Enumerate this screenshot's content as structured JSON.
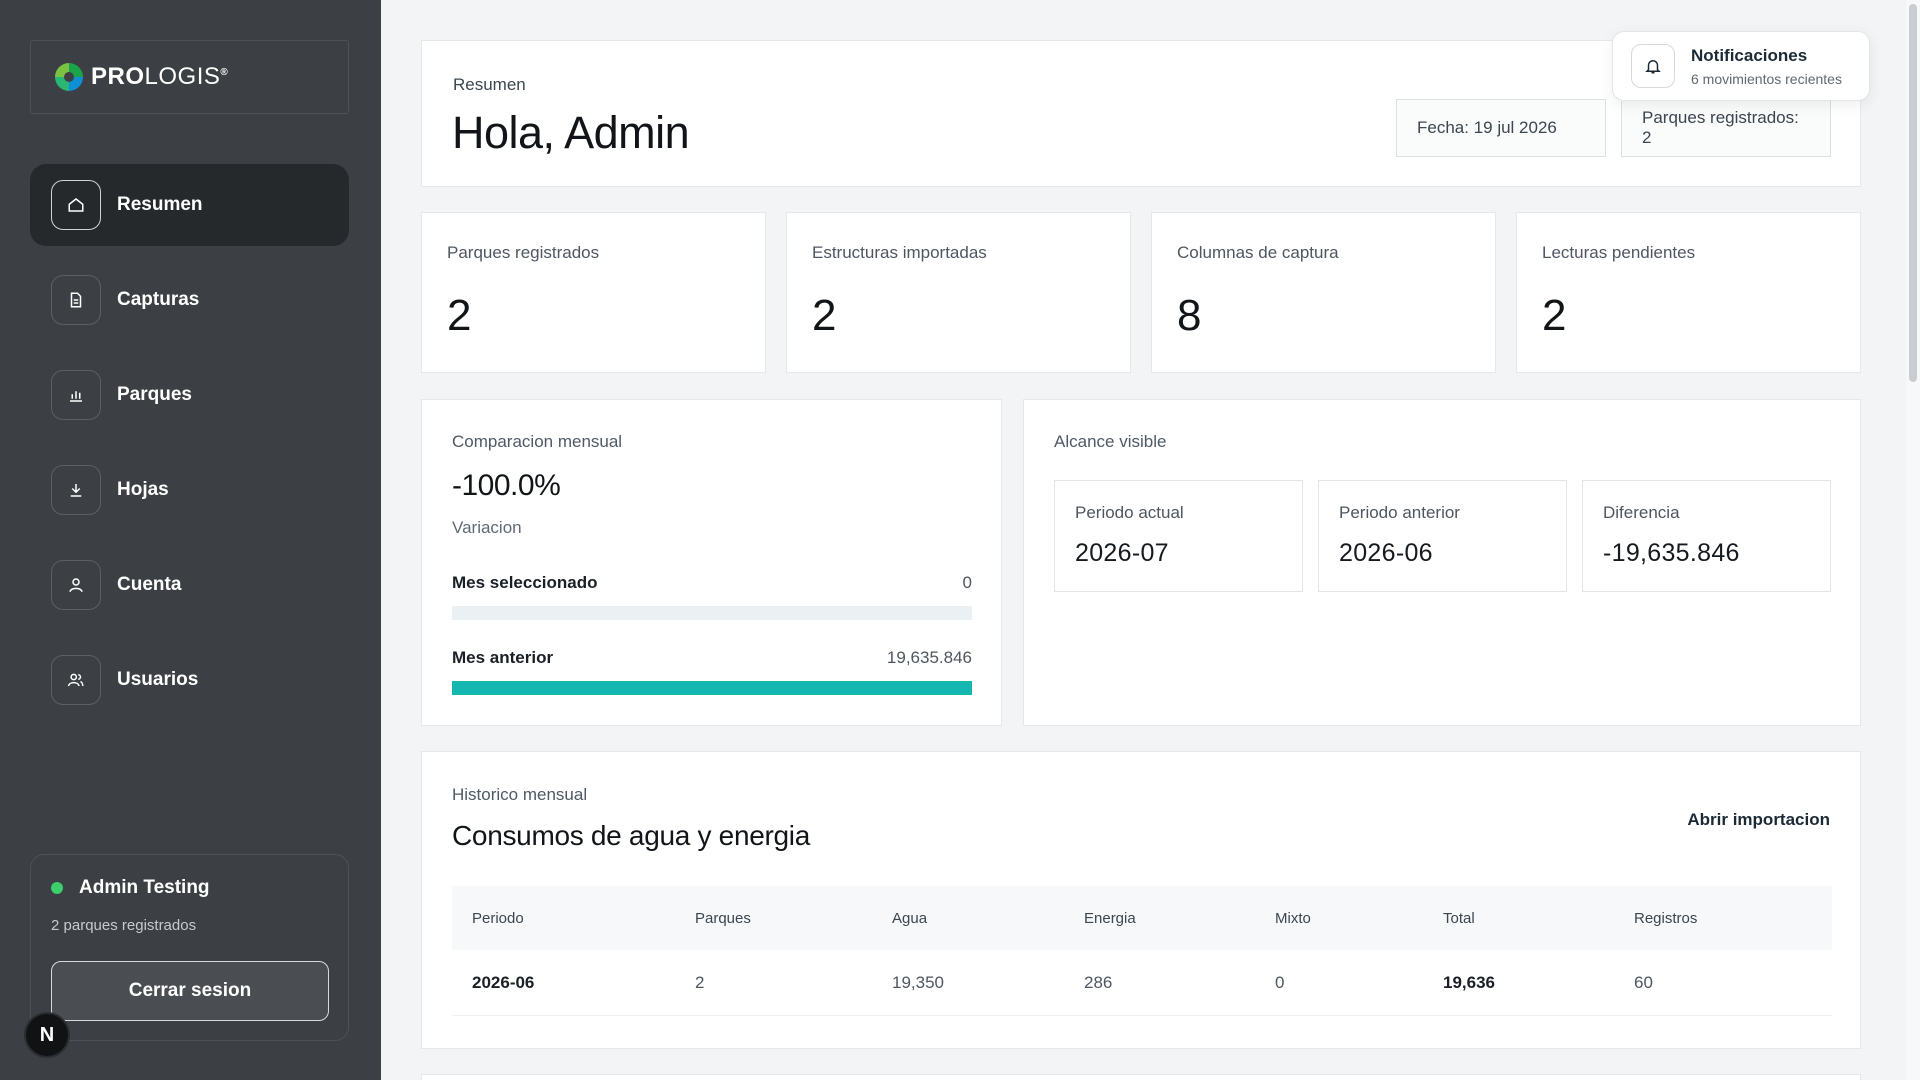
{
  "brand": {
    "name_bold": "PRO",
    "name_light": "LOGIS",
    "reg": "®"
  },
  "nav": [
    {
      "label": "Resumen",
      "icon": "home-icon",
      "active": true
    },
    {
      "label": "Capturas",
      "icon": "document-icon"
    },
    {
      "label": "Parques",
      "icon": "bar-chart-icon"
    },
    {
      "label": "Hojas",
      "icon": "download-icon"
    },
    {
      "label": "Cuenta",
      "icon": "user-icon"
    },
    {
      "label": "Usuarios",
      "icon": "users-icon"
    }
  ],
  "user": {
    "name": "Admin Testing",
    "sub": "2 parques registrados",
    "logout": "Cerrar sesion",
    "status_color": "#3ccf6a"
  },
  "dev_badge": "N",
  "notifications": {
    "title": "Notificaciones",
    "sub": "6 movimientos recientes"
  },
  "header": {
    "label": "Resumen",
    "title": "Hola, Admin",
    "date_pill": "Fecha: 19 jul 2026",
    "parks_pill": "Parques registrados: 2"
  },
  "stats": [
    {
      "label": "Parques registrados",
      "value": "2"
    },
    {
      "label": "Estructuras importadas",
      "value": "2"
    },
    {
      "label": "Columnas de captura",
      "value": "8"
    },
    {
      "label": "Lecturas pendientes",
      "value": "2"
    }
  ],
  "comparison": {
    "label": "Comparacion mensual",
    "value": "-100.0%",
    "sub": "Variacion",
    "current": {
      "name": "Mes seleccionado",
      "value": "0",
      "fraction": 0
    },
    "previous": {
      "name": "Mes anterior",
      "value": "19,635.846",
      "fraction": 1
    },
    "accent": "#14b8b0"
  },
  "scope": {
    "label": "Alcance visible",
    "items": [
      {
        "label": "Periodo actual",
        "value": "2026-07"
      },
      {
        "label": "Periodo anterior",
        "value": "2026-06"
      },
      {
        "label": "Diferencia",
        "value": "-19,635.846"
      }
    ]
  },
  "history": {
    "label": "Historico mensual",
    "title": "Consumos de agua y energia",
    "link": "Abrir importacion",
    "columns": [
      "Periodo",
      "Parques",
      "Agua",
      "Energia",
      "Mixto",
      "Total",
      "Registros"
    ],
    "rows": [
      [
        "2026-06",
        "2",
        "19,350",
        "286",
        "0",
        "19,636",
        "60"
      ]
    ]
  }
}
